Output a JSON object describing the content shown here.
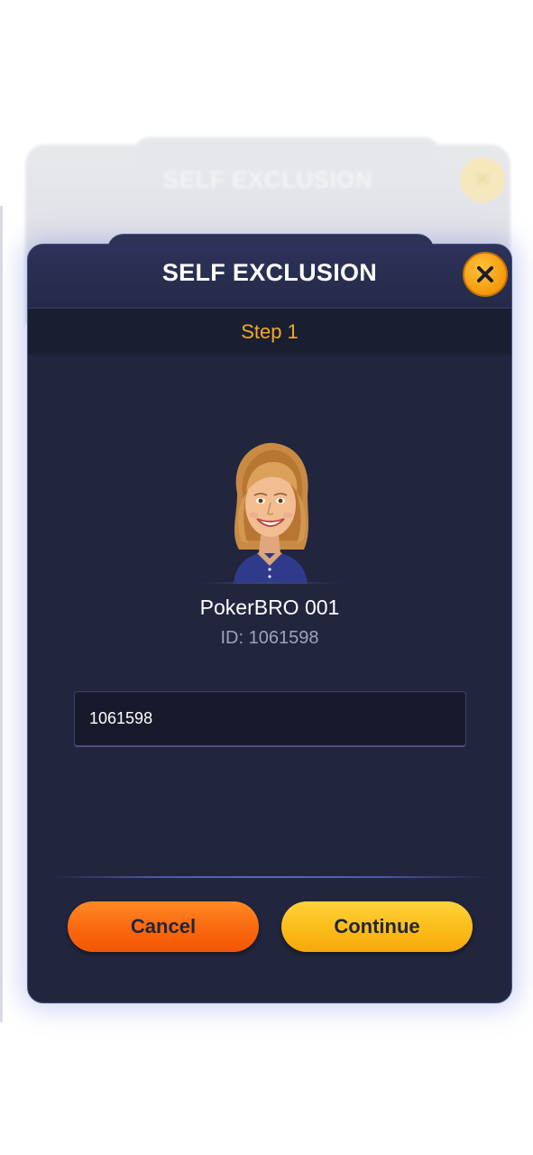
{
  "background_modal": {
    "title": "SELF EXCLUSION",
    "close_icon": "close-icon"
  },
  "modal": {
    "title": "SELF EXCLUSION",
    "close_icon": "close-icon",
    "step_label": "Step 1",
    "accent_color": "#f0a92a"
  },
  "profile": {
    "avatar": "avatar-portrait",
    "name": "PokerBRO 001",
    "id_text": "ID: 1061598"
  },
  "id_field": {
    "value": "1061598"
  },
  "actions": {
    "cancel_label": "Cancel",
    "continue_label": "Continue",
    "cancel_color": "#f8620c",
    "continue_color": "#fbbb1a"
  }
}
